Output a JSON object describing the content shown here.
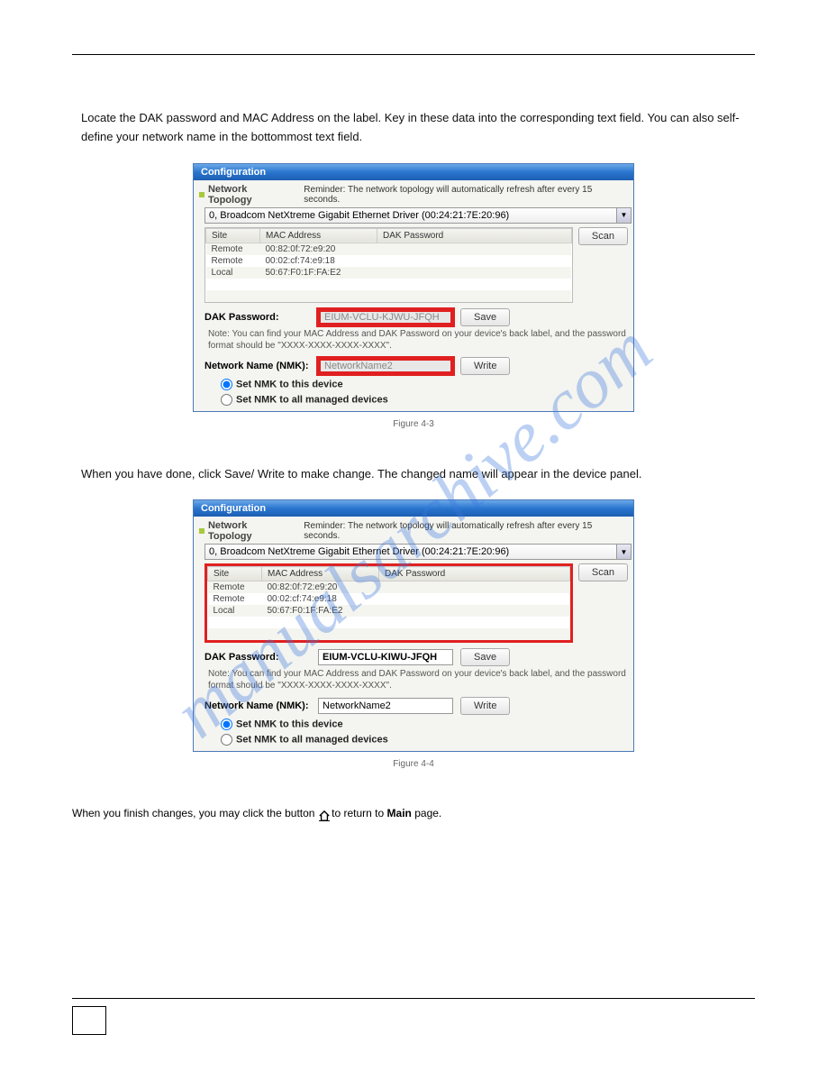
{
  "watermark": "manualsarchive.com",
  "para1": "Locate the DAK password and MAC Address on the label. Key in these data into the corresponding text field. You can also self-define your network name in the bottommost text field.",
  "para2": "When you have done, click Save/ Write to make change. The changed name will appear in the device panel.",
  "figure1_caption": "Figure 4-3",
  "figure2_caption": "Figure 4-4",
  "footer_text_1": "When you finish changes, you may click the button ",
  "footer_text_2": " to return to ",
  "footer_text_3": " page.",
  "footer_bold": "Main",
  "page_number": "",
  "window": {
    "title": "Configuration",
    "topology_label": "Network Topology",
    "reminder": "Reminder: The network topology will automatically refresh after every 15 seconds.",
    "dropdown_value": "0, Broadcom NetXtreme Gigabit Ethernet Driver (00:24:21:7E:20:96)",
    "scan_label": "Scan",
    "save_label": "Save",
    "write_label": "Write",
    "columns": {
      "site": "Site",
      "mac": "MAC Address",
      "dak": "DAK Password"
    },
    "rows": [
      {
        "site": "Remote",
        "mac": "00:82:0f:72:e9:20",
        "dak": ""
      },
      {
        "site": "Remote",
        "mac": "00:02:cf:74:e9:18",
        "dak": ""
      },
      {
        "site": "Local",
        "mac": "50:67:F0:1F:FA:E2",
        "dak": ""
      }
    ],
    "dak_label": "DAK Password:",
    "dak_value1": "EIUM-VCLU-KJWU-JFQH",
    "dak_value2": "EIUM-VCLU-KIWU-JFQH",
    "note": "Note: You can find your MAC Address and DAK Password on your device's back label, and the password format should be \"XXXX-XXXX-XXXX-XXXX\".",
    "nmk_label": "Network Name (NMK):",
    "nmk_value1": "NetworkName2",
    "nmk_value2": "NetworkName2",
    "radio1": "Set NMK to this device",
    "radio2": "Set NMK to all managed devices"
  }
}
